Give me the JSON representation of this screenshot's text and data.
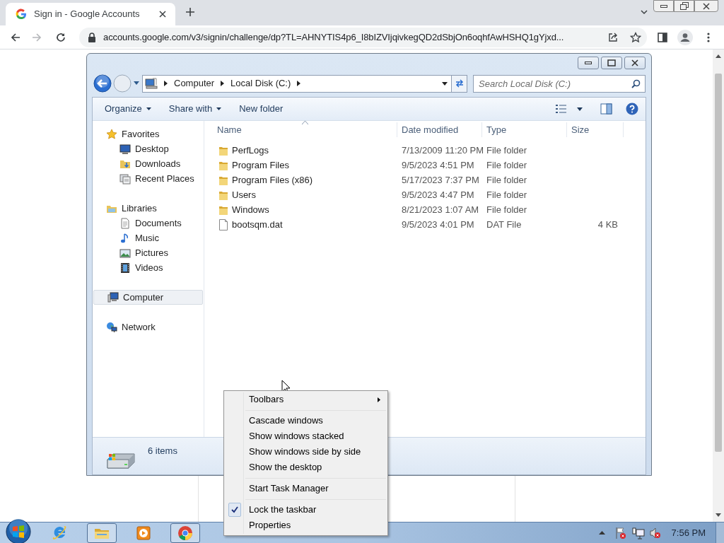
{
  "browser": {
    "tab_title": "Sign in - Google Accounts",
    "url": "accounts.google.com/v3/signin/challenge/dp?TL=AHNYTIS4p6_I8bIZVIjqivkegQD2dSbjOn6oqhfAwHSHQ1gYjxd..."
  },
  "explorer": {
    "path": [
      "Computer",
      "Local Disk (C:)"
    ],
    "search_placeholder": "Search Local Disk (C:)",
    "commands": [
      {
        "label": "Organize",
        "has_menu": true
      },
      {
        "label": "Share with",
        "has_menu": true
      },
      {
        "label": "New folder",
        "has_menu": false
      }
    ],
    "nav": [
      {
        "label": "Favorites",
        "kind": "star",
        "selected": false,
        "children": [
          {
            "label": "Desktop",
            "kind": "desktop",
            "selected": false
          },
          {
            "label": "Downloads",
            "kind": "downloads",
            "selected": false
          },
          {
            "label": "Recent Places",
            "kind": "recent",
            "selected": false
          }
        ]
      },
      {
        "label": "Libraries",
        "kind": "library",
        "selected": false,
        "children": [
          {
            "label": "Documents",
            "kind": "document",
            "selected": false
          },
          {
            "label": "Music",
            "kind": "music",
            "selected": false
          },
          {
            "label": "Pictures",
            "kind": "picture",
            "selected": false
          },
          {
            "label": "Videos",
            "kind": "video",
            "selected": false
          }
        ]
      },
      {
        "label": "Computer",
        "kind": "computer",
        "selected": true
      },
      {
        "label": "Network",
        "kind": "network",
        "selected": false
      }
    ],
    "columns": [
      "Name",
      "Date modified",
      "Type",
      "Size"
    ],
    "files": [
      {
        "kind": "folder",
        "name": "PerfLogs",
        "date": "7/13/2009 11:20 PM",
        "type": "File folder"
      },
      {
        "kind": "folder",
        "name": "Program Files",
        "date": "9/5/2023 4:51 PM",
        "type": "File folder"
      },
      {
        "kind": "folder",
        "name": "Program Files (x86)",
        "date": "5/17/2023 7:37 PM",
        "type": "File folder"
      },
      {
        "kind": "folder",
        "name": "Users",
        "date": "9/5/2023 4:47 PM",
        "type": "File folder"
      },
      {
        "kind": "folder",
        "name": "Windows",
        "date": "8/21/2023 1:07 AM",
        "type": "File folder"
      },
      {
        "kind": "file",
        "name": "bootsqm.dat",
        "date": "9/5/2023 4:01 PM",
        "type": "DAT File",
        "size": "4 KB"
      }
    ],
    "status": "6 items"
  },
  "context_menu": [
    {
      "kind": "item",
      "label": "Toolbars",
      "submenu": true,
      "checked": false
    },
    {
      "kind": "separator"
    },
    {
      "kind": "item",
      "label": "Cascade windows",
      "submenu": false,
      "checked": false
    },
    {
      "kind": "item",
      "label": "Show windows stacked",
      "submenu": false,
      "checked": false
    },
    {
      "kind": "item",
      "label": "Show windows side by side",
      "submenu": false,
      "checked": false
    },
    {
      "kind": "item",
      "label": "Show the desktop",
      "submenu": false,
      "checked": false
    },
    {
      "kind": "separator"
    },
    {
      "kind": "item",
      "label": "Start Task Manager",
      "submenu": false,
      "checked": false
    },
    {
      "kind": "separator"
    },
    {
      "kind": "item",
      "label": "Lock the taskbar",
      "submenu": false,
      "checked": true
    },
    {
      "kind": "item",
      "label": "Properties",
      "submenu": false,
      "checked": false
    }
  ],
  "taskbar": {
    "apps": [
      {
        "kind": "ie",
        "running": false
      },
      {
        "kind": "explorer",
        "running": true
      },
      {
        "kind": "media",
        "running": false
      },
      {
        "kind": "chrome",
        "running": true
      }
    ],
    "clock": "7:56 PM"
  }
}
